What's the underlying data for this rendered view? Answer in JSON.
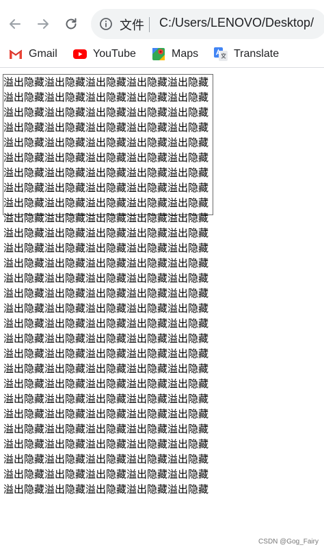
{
  "browser": {
    "scheme_label": "文件",
    "url": "C:/Users/LENOVO/Desktop/"
  },
  "bookmarks": [
    {
      "label": "Gmail",
      "icon": "gmail-icon"
    },
    {
      "label": "YouTube",
      "icon": "youtube-icon"
    },
    {
      "label": "Maps",
      "icon": "maps-icon"
    },
    {
      "label": "Translate",
      "icon": "translate-icon"
    }
  ],
  "page": {
    "overflow_text": "溢出隐藏溢出隐藏溢出隐藏溢出隐藏溢出隐藏 溢出隐藏溢出隐藏溢出隐藏溢出隐藏溢出隐藏 溢出隐藏溢出隐藏溢出隐藏溢出隐藏溢出隐藏 溢出隐藏溢出隐藏溢出隐藏溢出隐藏溢出隐藏 溢出隐藏溢出隐藏溢出隐藏溢出隐藏溢出隐藏 溢出隐藏溢出隐藏溢出隐藏溢出隐藏溢出隐藏 溢出隐藏溢出隐藏溢出隐藏溢出隐藏溢出隐藏 溢出隐藏溢出隐藏溢出隐藏溢出隐藏溢出隐藏 溢出隐藏溢出隐藏溢出隐藏溢出隐藏溢出隐藏 溢出隐藏溢出隐藏溢出隐藏溢出隐藏溢出隐藏 溢出隐藏溢出隐藏溢出隐藏溢出隐藏溢出隐藏 溢出隐藏溢出隐藏溢出隐藏溢出隐藏溢出隐藏 溢出隐藏溢出隐藏溢出隐藏溢出隐藏溢出隐藏 溢出隐藏溢出隐藏溢出隐藏溢出隐藏溢出隐藏 溢出隐藏溢出隐藏溢出隐藏溢出隐藏溢出隐藏 溢出隐藏溢出隐藏溢出隐藏溢出隐藏溢出隐藏 溢出隐藏溢出隐藏溢出隐藏溢出隐藏溢出隐藏 溢出隐藏溢出隐藏溢出隐藏溢出隐藏溢出隐藏 溢出隐藏溢出隐藏溢出隐藏溢出隐藏溢出隐藏 溢出隐藏溢出隐藏溢出隐藏溢出隐藏溢出隐藏 溢出隐藏溢出隐藏溢出隐藏溢出隐藏溢出隐藏 溢出隐藏溢出隐藏溢出隐藏溢出隐藏溢出隐藏 溢出隐藏溢出隐藏溢出隐藏溢出隐藏溢出隐藏 溢出隐藏溢出隐藏溢出隐藏溢出隐藏溢出隐藏 溢出隐藏溢出隐藏溢出隐藏溢出隐藏溢出隐藏 溢出隐藏溢出隐藏溢出隐藏溢出隐藏溢出隐藏 溢出隐藏溢出隐藏溢出隐藏溢出隐藏溢出隐藏 溢出隐藏溢出隐藏溢出隐藏溢出隐藏溢出隐藏"
  },
  "watermark": "CSDN @Gog_Fairy",
  "colors": {
    "omnibox_bg": "#f1f3f4",
    "gmail_red": "#ea4335",
    "youtube_red": "#ff0000",
    "translate_blue": "#4285f4"
  }
}
